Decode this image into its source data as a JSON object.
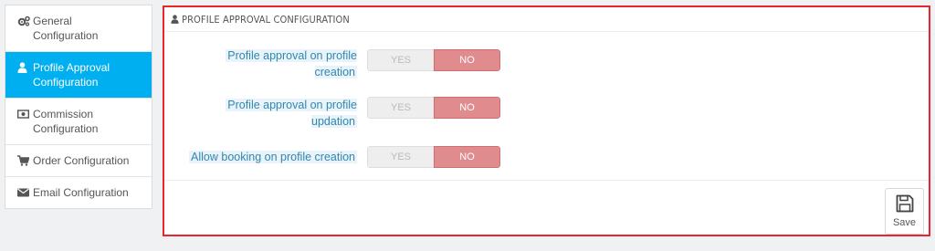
{
  "sidebar": {
    "items": [
      {
        "label": "General Configuration",
        "icon": "gears-icon",
        "active": false
      },
      {
        "label": "Profile Approval Configuration",
        "icon": "user-icon",
        "active": true
      },
      {
        "label": "Commission Configuration",
        "icon": "money-icon",
        "active": false
      },
      {
        "label": "Order Configuration",
        "icon": "cart-icon",
        "active": false
      },
      {
        "label": "Email Configuration",
        "icon": "envelope-icon",
        "active": false
      }
    ]
  },
  "panel": {
    "title": "PROFILE APPROVAL CONFIGURATION",
    "title_icon": "user-icon",
    "fields": [
      {
        "label": "Profile approval on profile creation",
        "yes_label": "YES",
        "no_label": "NO",
        "selected": "NO"
      },
      {
        "label": "Profile approval on profile updation",
        "yes_label": "YES",
        "no_label": "NO",
        "selected": "NO"
      },
      {
        "label": "Allow booking on profile creation",
        "yes_label": "YES",
        "no_label": "NO",
        "selected": "NO"
      }
    ],
    "save_label": "Save",
    "save_icon": "floppy-disk-icon"
  },
  "colors": {
    "active": "#00aff0",
    "no_selected": "#e08c8f",
    "highlight_border": "#e8262c",
    "label": "#3586ae"
  }
}
